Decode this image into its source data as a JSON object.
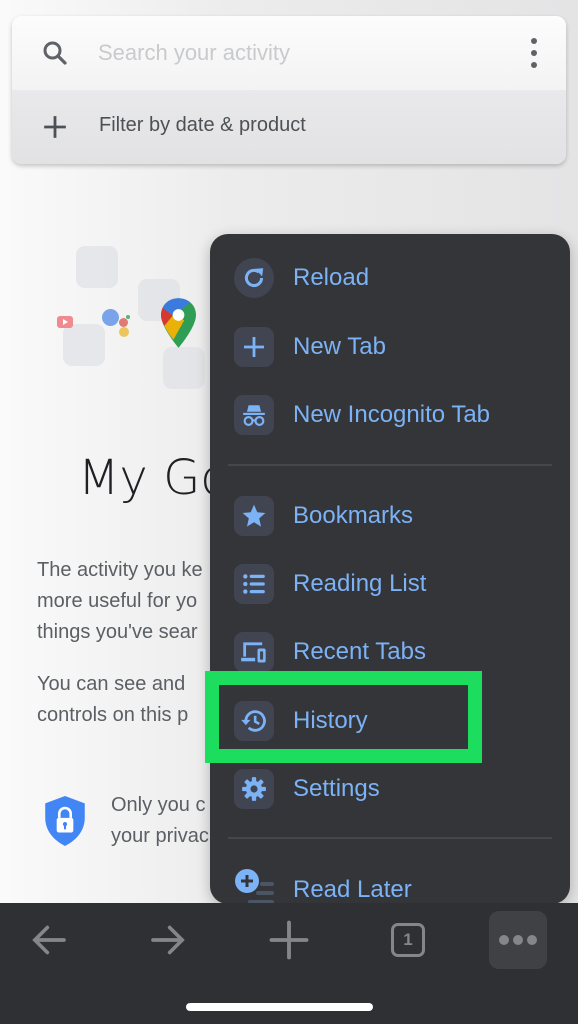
{
  "search": {
    "placeholder": "Search your activity",
    "value": "",
    "filter_label": "Filter by date & product"
  },
  "page": {
    "title": "My Go",
    "paragraph1": [
      "The activity you ke",
      "more useful for yo",
      "things you've sear"
    ],
    "paragraph2": [
      "You can see and",
      "controls on this p"
    ],
    "privacy": [
      "Only you c",
      "your privac"
    ]
  },
  "menu": {
    "items": [
      {
        "label": "Reload",
        "icon": "reload-icon"
      },
      {
        "label": "New Tab",
        "icon": "plus-icon"
      },
      {
        "label": "New Incognito Tab",
        "icon": "incognito-icon"
      },
      {
        "label": "Bookmarks",
        "icon": "star-icon"
      },
      {
        "label": "Reading List",
        "icon": "list-icon"
      },
      {
        "label": "Recent Tabs",
        "icon": "devices-icon"
      },
      {
        "label": "History",
        "icon": "history-icon"
      },
      {
        "label": "Settings",
        "icon": "gear-icon"
      },
      {
        "label": "Read Later",
        "icon": "read-later-icon"
      }
    ],
    "highlighted": "History"
  },
  "toolbar": {
    "tab_count": "1"
  },
  "colors": {
    "menu_bg": "#343538",
    "menu_text": "#7cb2f6",
    "highlight": "#1cdd5e",
    "toolbar_bg": "#2f3033"
  }
}
